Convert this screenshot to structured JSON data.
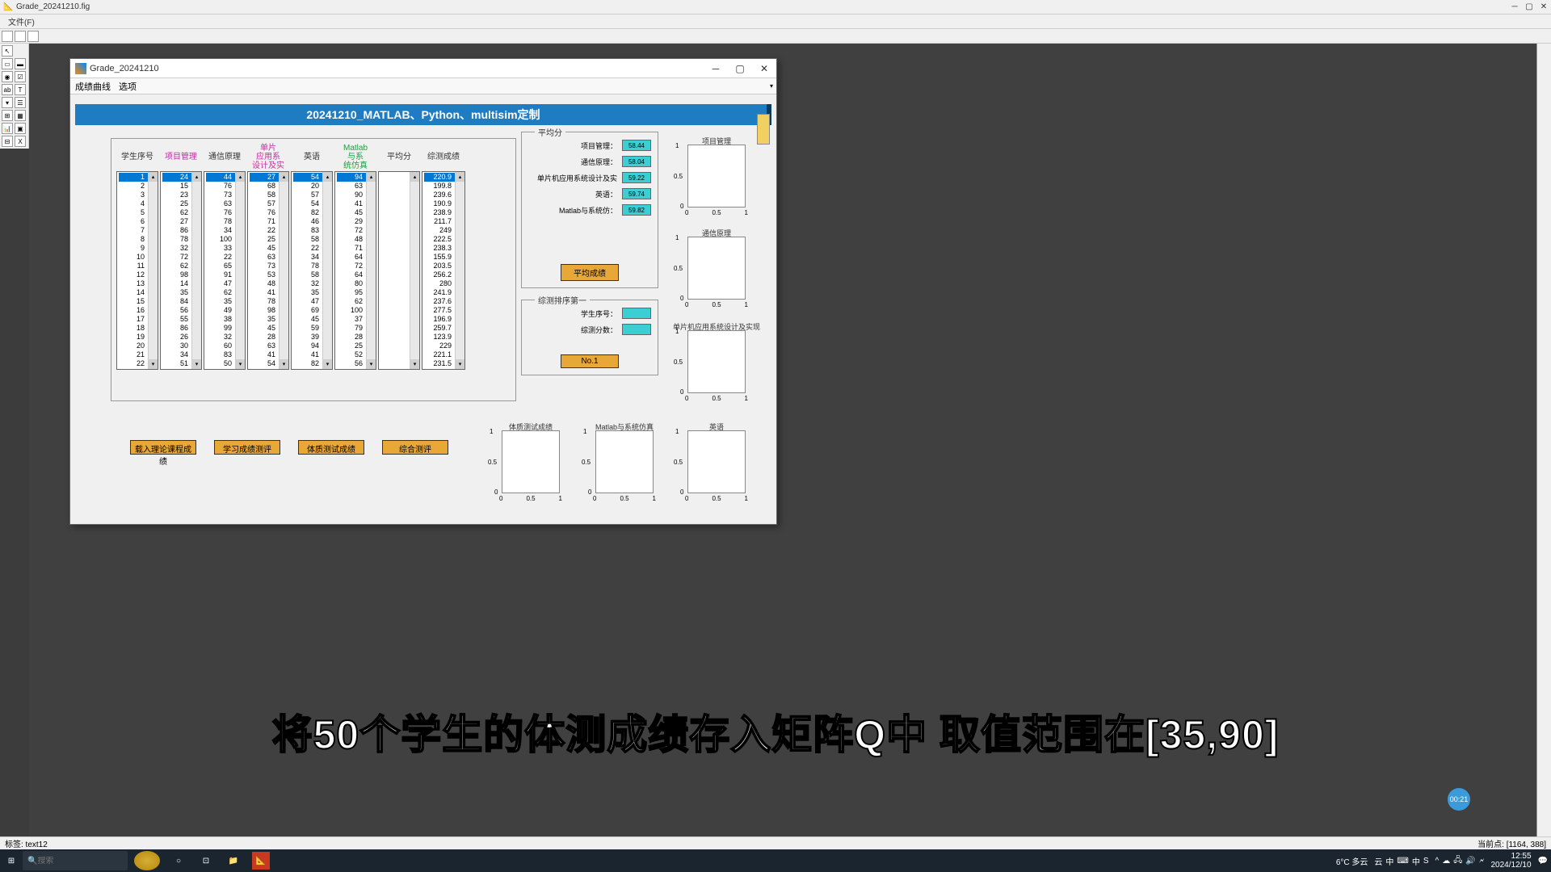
{
  "ide": {
    "title": "Grade_20241210.fig",
    "menu": {
      "file": "文件(F)"
    }
  },
  "fig": {
    "title": "Grade_20241210",
    "menu": {
      "curve": "成绩曲线",
      "options": "选项"
    },
    "heading": "20241210_MATLAB、Python、multisim定制"
  },
  "columns": {
    "student": "学生序号",
    "projmgmt": "项目管理",
    "comm": "通信原理",
    "mcu": "单片\n应用系\n设计及实",
    "english": "英语",
    "matlab": "Matlab\n与系\n统仿真",
    "avg": "平均分",
    "comp": "综测成绩"
  },
  "lists": {
    "student": [
      "1",
      "2",
      "3",
      "4",
      "5",
      "6",
      "7",
      "8",
      "9",
      "10",
      "11",
      "12",
      "13",
      "14",
      "15",
      "16",
      "17",
      "18",
      "19",
      "20",
      "21",
      "22"
    ],
    "projmgmt": [
      "24",
      "15",
      "23",
      "25",
      "62",
      "27",
      "86",
      "78",
      "32",
      "72",
      "62",
      "98",
      "14",
      "35",
      "84",
      "56",
      "55",
      "86",
      "26",
      "30",
      "34",
      "51"
    ],
    "comm": [
      "44",
      "76",
      "73",
      "63",
      "76",
      "78",
      "34",
      "100",
      "33",
      "22",
      "65",
      "91",
      "47",
      "62",
      "35",
      "49",
      "38",
      "99",
      "32",
      "60",
      "83",
      "50"
    ],
    "mcu": [
      "27",
      "68",
      "58",
      "57",
      "76",
      "71",
      "22",
      "25",
      "45",
      "63",
      "73",
      "53",
      "48",
      "41",
      "78",
      "98",
      "35",
      "45",
      "28",
      "63",
      "41",
      "54"
    ],
    "english": [
      "54",
      "20",
      "57",
      "54",
      "82",
      "46",
      "83",
      "58",
      "22",
      "34",
      "78",
      "58",
      "32",
      "35",
      "47",
      "69",
      "45",
      "59",
      "39",
      "94",
      "41",
      "82"
    ],
    "matlab": [
      "94",
      "63",
      "90",
      "41",
      "45",
      "29",
      "72",
      "48",
      "71",
      "64",
      "72",
      "64",
      "80",
      "95",
      "62",
      "100",
      "37",
      "79",
      "28",
      "25",
      "52",
      "56"
    ],
    "comp": [
      "220.9",
      "199.8",
      "239.6",
      "190.9",
      "238.9",
      "211.7",
      "249",
      "222.5",
      "238.3",
      "155.9",
      "203.5",
      "256.2",
      "280",
      "241.9",
      "237.6",
      "277.5",
      "196.9",
      "259.7",
      "123.9",
      "229",
      "221.1",
      "231.5"
    ]
  },
  "avg_panel": {
    "title": "平均分",
    "projmgmt_l": "项目管理：",
    "projmgmt_v": "58.44",
    "comm_l": "通信原理：",
    "comm_v": "58.04",
    "mcu_l": "单片机应用系统设计及实",
    "mcu_v": "59.22",
    "english_l": "英语：",
    "english_v": "59.74",
    "matlab_l": "Matlab与系统仿：",
    "matlab_v": "59.82",
    "button": "平均成绩"
  },
  "rank_panel": {
    "title": "综测排序第一",
    "id_l": "学生序号：",
    "score_l": "综测分数：",
    "button": "No.1"
  },
  "plots": {
    "p1": "项目管理",
    "p2": "通信原理",
    "p3": "单片机应用系统设计及实现",
    "p4": "体质测试成绩",
    "p5": "Matlab与系统仿真",
    "p6": "英语"
  },
  "buttons": {
    "b1": "载入理论课程成绩",
    "b2": "学习成绩测评",
    "b3": "体质测试成绩",
    "b4": "综合测评"
  },
  "status": {
    "left": "标签: text12",
    "right": "当前点: [1164, 388]"
  },
  "subtitle": "将50个学生的体测成绩存入矩阵Q中 取值范围在[35,90]",
  "badge": "00:21",
  "taskbar": {
    "search": "搜索",
    "weather": "6°C 多云",
    "time": "12:55",
    "date": "2024/12/10",
    "lang_items": [
      "云",
      "中",
      "⌨",
      "中",
      "S"
    ]
  }
}
